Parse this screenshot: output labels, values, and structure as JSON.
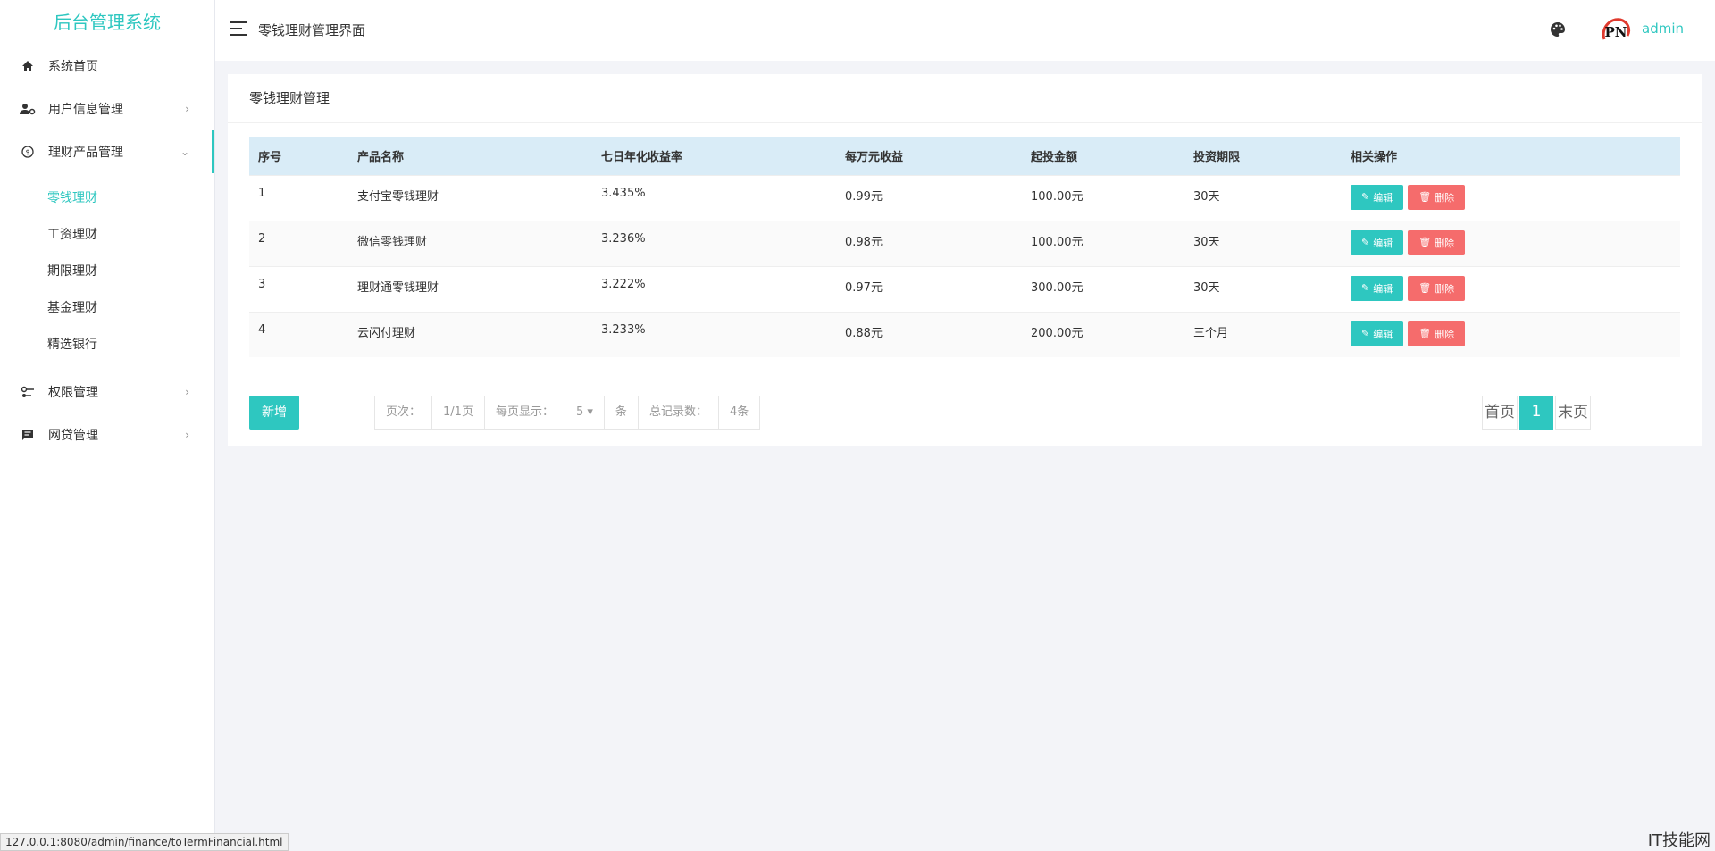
{
  "sidebar": {
    "logo": "后台管理系统",
    "menu": [
      {
        "label": "系统首页",
        "icon": "home-icon"
      },
      {
        "label": "用户信息管理",
        "icon": "user-settings-icon"
      },
      {
        "label": "理财产品管理",
        "icon": "money-icon"
      },
      {
        "label": "权限管理",
        "icon": "key-icon"
      },
      {
        "label": "网贷管理",
        "icon": "message-icon"
      }
    ],
    "submenu": [
      "零钱理财",
      "工资理财",
      "期限理财",
      "基金理财",
      "精选银行"
    ]
  },
  "header": {
    "title": "零钱理财管理界面",
    "user": "admin",
    "avatar_text": "PN"
  },
  "card": {
    "title": "零钱理财管理",
    "columns": [
      "序号",
      "产品名称",
      "七日年化收益率",
      "每万元收益",
      "起投金额",
      "投资期限",
      "相关操作"
    ],
    "rows": [
      {
        "id": "1",
        "name": "支付宝零钱理财",
        "rate": "3.435%",
        "per10k": "0.99元",
        "min": "100.00元",
        "term": "30天"
      },
      {
        "id": "2",
        "name": "微信零钱理财",
        "rate": "3.236%",
        "per10k": "0.98元",
        "min": "100.00元",
        "term": "30天"
      },
      {
        "id": "3",
        "name": "理财通零钱理财",
        "rate": "3.222%",
        "per10k": "0.97元",
        "min": "300.00元",
        "term": "30天"
      },
      {
        "id": "4",
        "name": "云闪付理财",
        "rate": "3.233%",
        "per10k": "0.88元",
        "min": "200.00元",
        "term": "三个月"
      }
    ],
    "edit_label": "编辑",
    "delete_label": "删除",
    "add_label": "新增"
  },
  "pager": {
    "page_label": "页次：",
    "page_value": "1/1页",
    "per_page_label": "每页显示：",
    "per_page_value": "5",
    "unit": "条",
    "total_label": "总记录数：",
    "total_value": "4条",
    "first": "首页",
    "current": "1",
    "last": "末页"
  },
  "status_url": "127.0.0.1:8080/admin/finance/toTermFinancial.html",
  "watermark": "IT技能网",
  "colors": {
    "accent": "#2ec7c0",
    "danger": "#f56c6c",
    "table_header": "#d9ecf7"
  }
}
